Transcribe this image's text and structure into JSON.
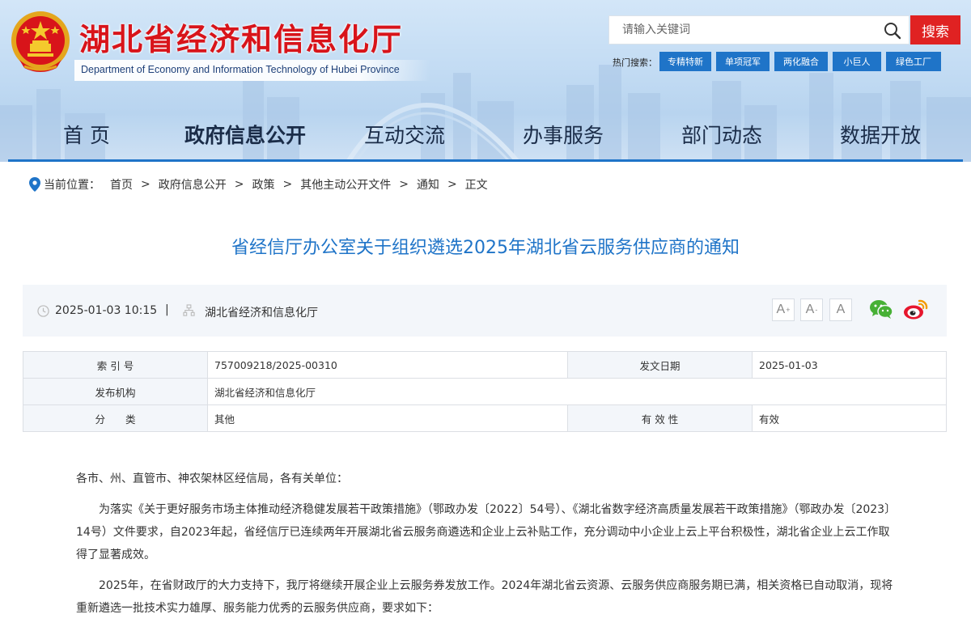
{
  "header": {
    "title": "湖北省经济和信息化厅",
    "subtitle": "Department of Economy and Information Technology of Hubei Province",
    "emblem_icon": "national-emblem-icon",
    "search": {
      "placeholder": "请输入关键词",
      "button_label": "搜索",
      "icon": "search-icon"
    },
    "hot_search": {
      "label": "热门搜索：",
      "tags": [
        "专精特新",
        "单项冠军",
        "两化融合",
        "小巨人",
        "绿色工厂"
      ]
    },
    "nav": [
      "首 页",
      "政府信息公开",
      "互动交流",
      "办事服务",
      "部门动态",
      "数据开放"
    ],
    "nav_active": "政府信息公开"
  },
  "breadcrumb": {
    "label": "当前位置：",
    "items": [
      "首页",
      "政府信息公开",
      "政策",
      "其他主动公开文件",
      "通知",
      "正文"
    ],
    "separator": ">"
  },
  "article": {
    "title": "省经信厅办公室关于组织遴选2025年湖北省云服务供应商的通知",
    "date": "2025-01-03 10:15",
    "divider": "|",
    "publisher": "湖北省经济和信息化厅",
    "font_controls": [
      {
        "letter": "A",
        "mark": "+"
      },
      {
        "letter": "A",
        "mark": "-"
      },
      {
        "letter": "A",
        "mark": ""
      }
    ]
  },
  "info_table": {
    "rows": [
      {
        "label1": "索 引 号",
        "value1": "757009218/2025-00310",
        "label2": "发文日期",
        "value2": "2025-01-03"
      },
      {
        "label1": "发布机构",
        "value1": "湖北省经济和信息化厅"
      },
      {
        "label1": "分　　类",
        "value1": "其他",
        "label2": "有 效 性",
        "value2": "有效"
      }
    ]
  },
  "body": {
    "salutation": "各市、州、直管市、神农架林区经信局，各有关单位：",
    "paragraphs": [
      "为落实《关于更好服务市场主体推动经济稳健发展若干政策措施》（鄂政办发〔2022〕54号）、《湖北省数字经济高质量发展若干政策措施》（鄂政办发〔2023〕14号）文件要求，自2023年起，省经信厅已连续两年开展湖北省云服务商遴选和企业上云补贴工作，充分调动中小企业上云上平台积极性，湖北省企业上云工作取得了显著成效。",
      "2025年，在省财政厅的大力支持下，我厅将继续开展企业上云服务券发放工作。2024年湖北省云资源、云服务供应商服务期已满，相关资格已自动取消，现将重新遴选一批技术实力雄厚、服务能力优秀的云服务供应商，要求如下："
    ]
  },
  "colors": {
    "brand_red": "#d8141a",
    "brand_blue": "#1f74c8",
    "search_button": "#e02222",
    "meta_background": "#f3f6fa"
  }
}
